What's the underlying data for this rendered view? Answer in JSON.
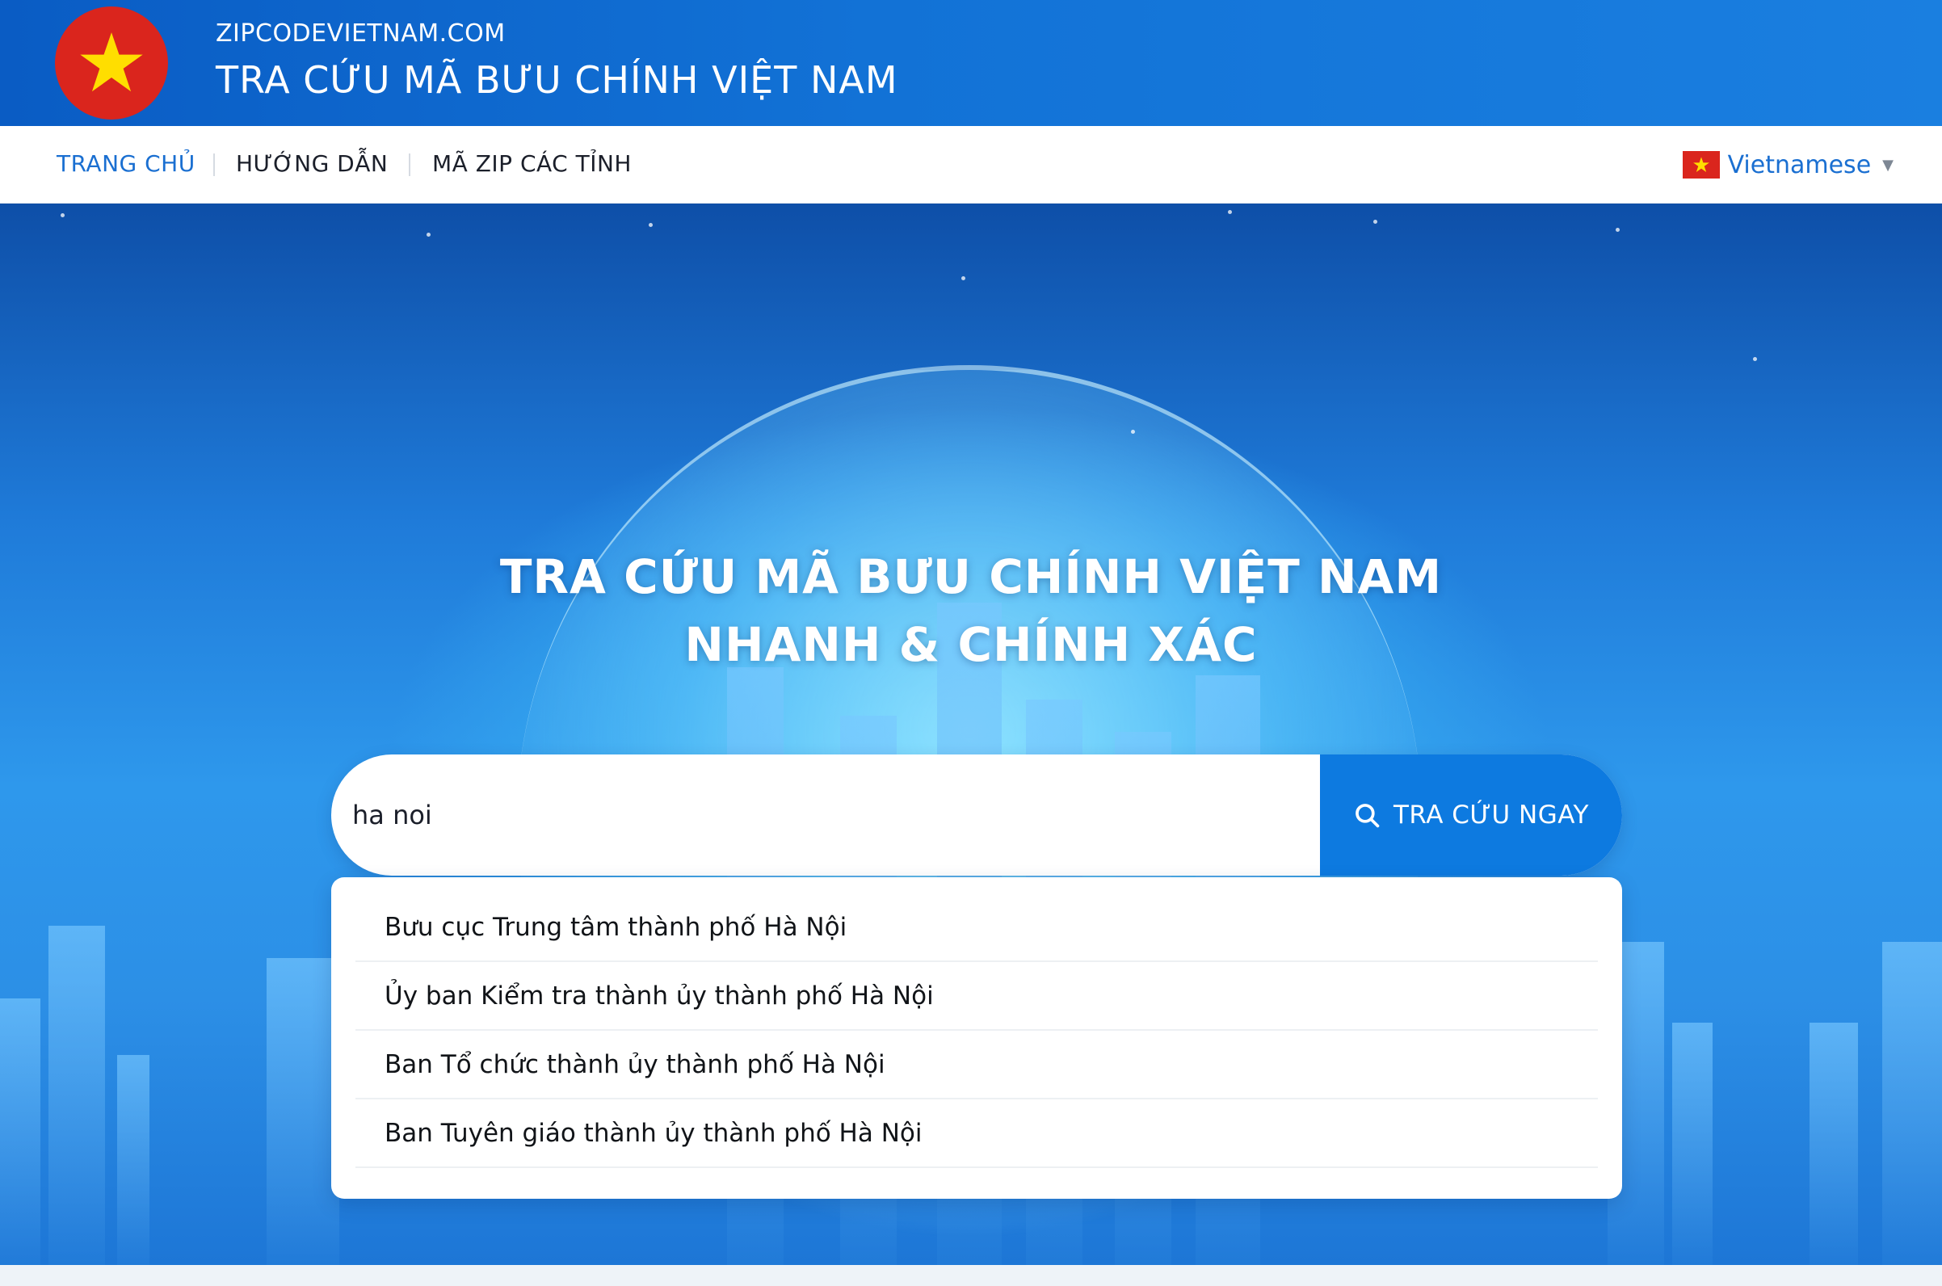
{
  "header": {
    "domain": "ZIPCODEVIETNAM.COM",
    "title": "TRA CỨU MÃ BƯU CHÍNH VIỆT NAM",
    "logo_icon": "vietnam-flag-star-icon"
  },
  "nav": {
    "items": [
      {
        "label": "TRANG CHỦ",
        "active": true
      },
      {
        "label": "HƯỚNG DẪN",
        "active": false
      },
      {
        "label": "MÃ ZIP CÁC TỈNH",
        "active": false
      }
    ],
    "language": {
      "label": "Vietnamese",
      "flag_icon": "vietnam-flag-icon",
      "caret": "▼"
    }
  },
  "hero": {
    "title_line1": "TRA CỨU MÃ BƯU CHÍNH VIỆT NAM",
    "title_line2": "NHANH & CHÍNH XÁC"
  },
  "search": {
    "value": "ha noi",
    "button_label": "TRA CỨU NGAY",
    "button_icon": "search-icon"
  },
  "suggestions": [
    "Bưu cục Trung tâm thành phố Hà Nội",
    "Ủy ban Kiểm tra thành ủy thành phố Hà Nội",
    "Ban Tổ chức thành ủy thành phố Hà Nội",
    "Ban Tuyên giáo thành ủy thành phố Hà Nội"
  ],
  "colors": {
    "header_blue": "#0a5cc4",
    "accent_blue": "#1a6fd1",
    "button_blue": "#0d7ae0",
    "flag_red": "#da251d",
    "flag_yellow": "#ffde00"
  }
}
